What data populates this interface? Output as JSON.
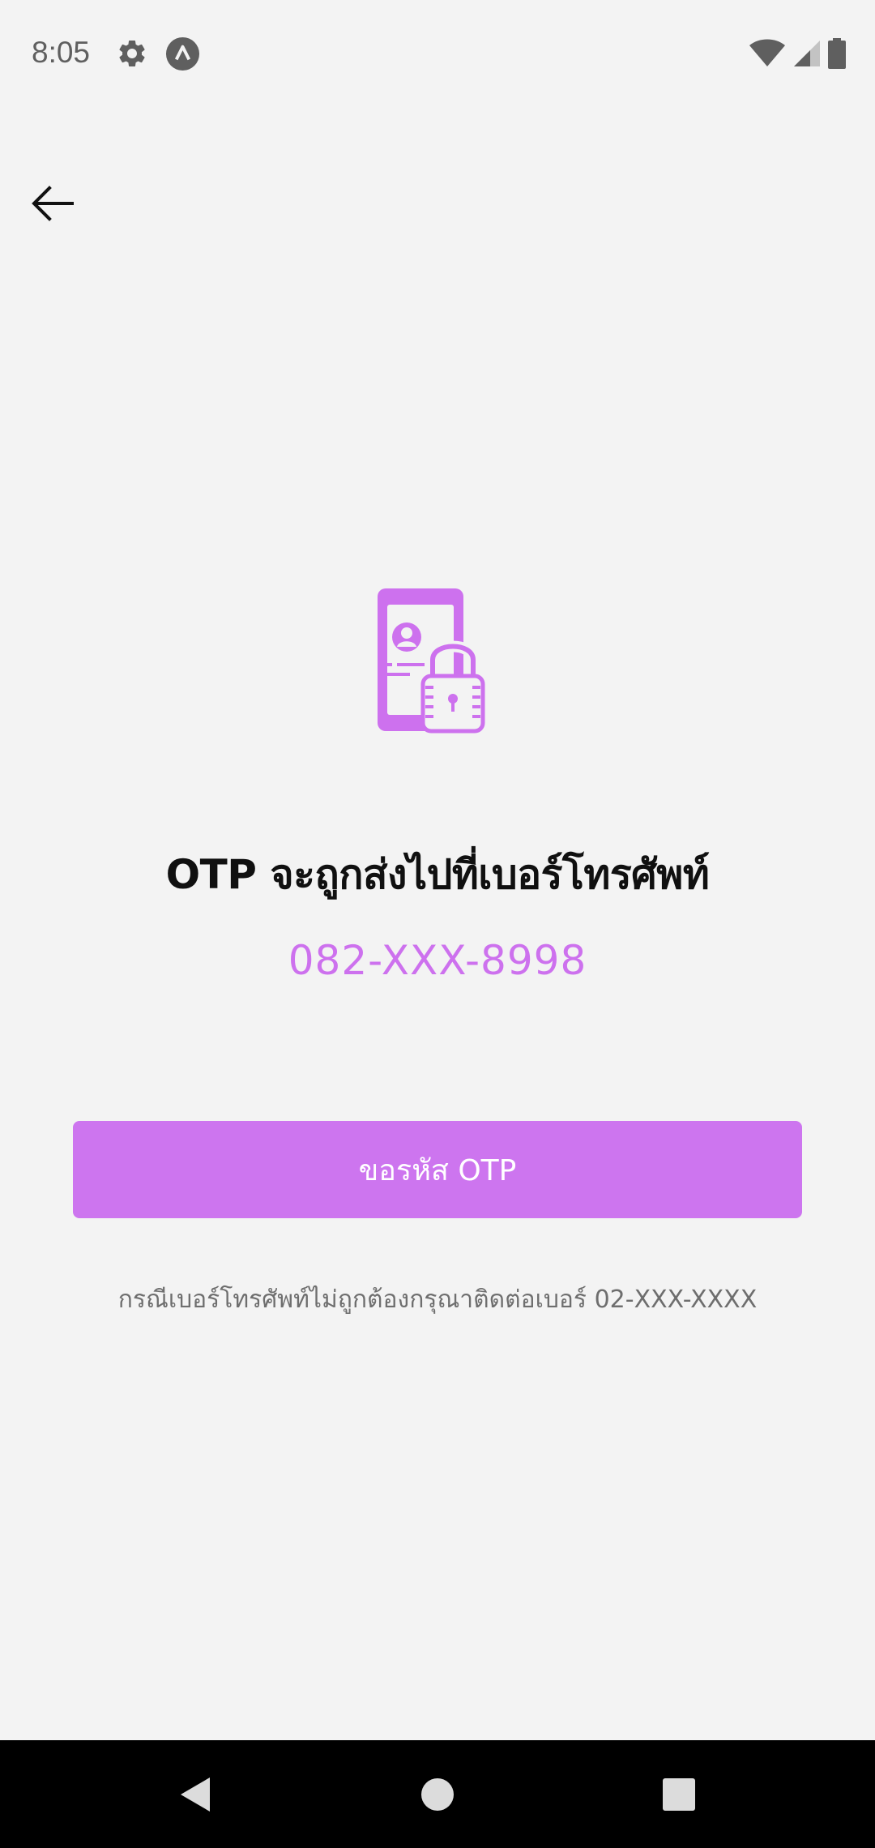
{
  "status_bar": {
    "time": "8:05",
    "icons": [
      "gear-icon",
      "a-badge-icon",
      "wifi-icon",
      "signal-icon",
      "battery-icon"
    ]
  },
  "app_bar": {
    "back_icon": "arrow-left-icon"
  },
  "illustration": {
    "icon": "phone-lock-icon",
    "color": "#cd71ee"
  },
  "otp": {
    "title": "OTP จะถูกส่งไปที่เบอร์โทรศัพท์",
    "phone_number": "082-XXX-8998",
    "request_button_label": "ขอรหัส OTP",
    "help_text": "กรณีเบอร์โทรศัพท์ไม่ถูกต้องกรุณาติดต่อเบอร์ 02-XXX-XXXX"
  },
  "nav_bar": {
    "icons": [
      "nav-back-icon",
      "nav-home-icon",
      "nav-recents-icon"
    ]
  },
  "colors": {
    "accent": "#cd75ef",
    "background": "#f3f3f3",
    "text_primary": "#101010",
    "text_secondary": "#6e6e6e"
  }
}
